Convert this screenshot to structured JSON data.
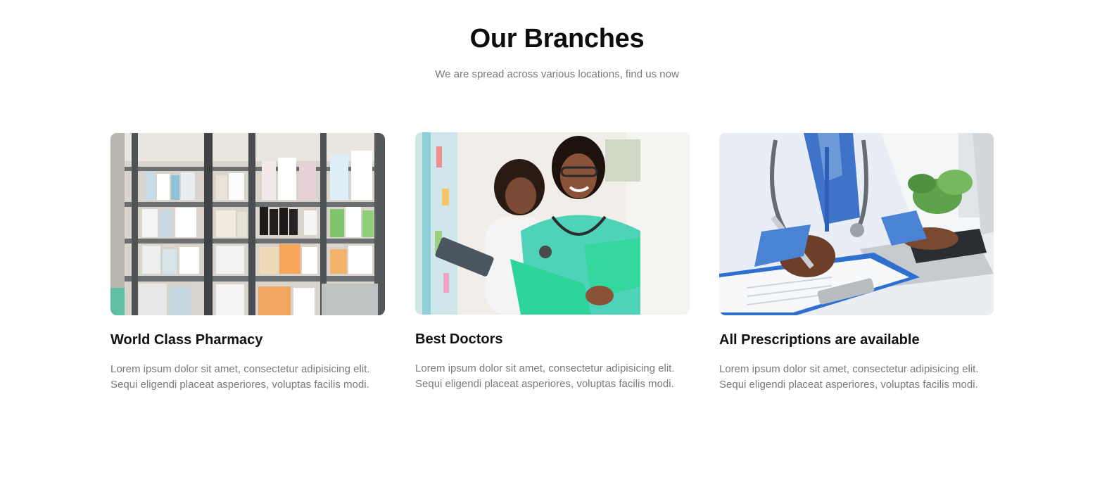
{
  "section": {
    "title": "Our Branches",
    "subtitle": "We are spread across various locations, find us now"
  },
  "cards": [
    {
      "heading": "World Class Pharmacy",
      "text": "Lorem ipsum dolor sit amet, consectetur adipisicing elit. Sequi eligendi placeat asperiores, voluptas facilis modi.",
      "image": "pharmacy-shelves-photo"
    },
    {
      "heading": "Best Doctors",
      "text": "Lorem ipsum dolor sit amet, consectetur adipisicing elit. Sequi eligendi placeat asperiores, voluptas facilis modi.",
      "image": "doctors-with-folder-photo"
    },
    {
      "heading": "All Prescriptions are available",
      "text": "Lorem ipsum dolor sit amet, consectetur adipisicing elit. Sequi eligendi placeat asperiores, voluptas facilis modi.",
      "image": "doctor-writing-prescription-photo"
    }
  ],
  "colors": {
    "title": "#0d0d0d",
    "muted_text": "#7a7a7a",
    "background": "#ffffff"
  }
}
